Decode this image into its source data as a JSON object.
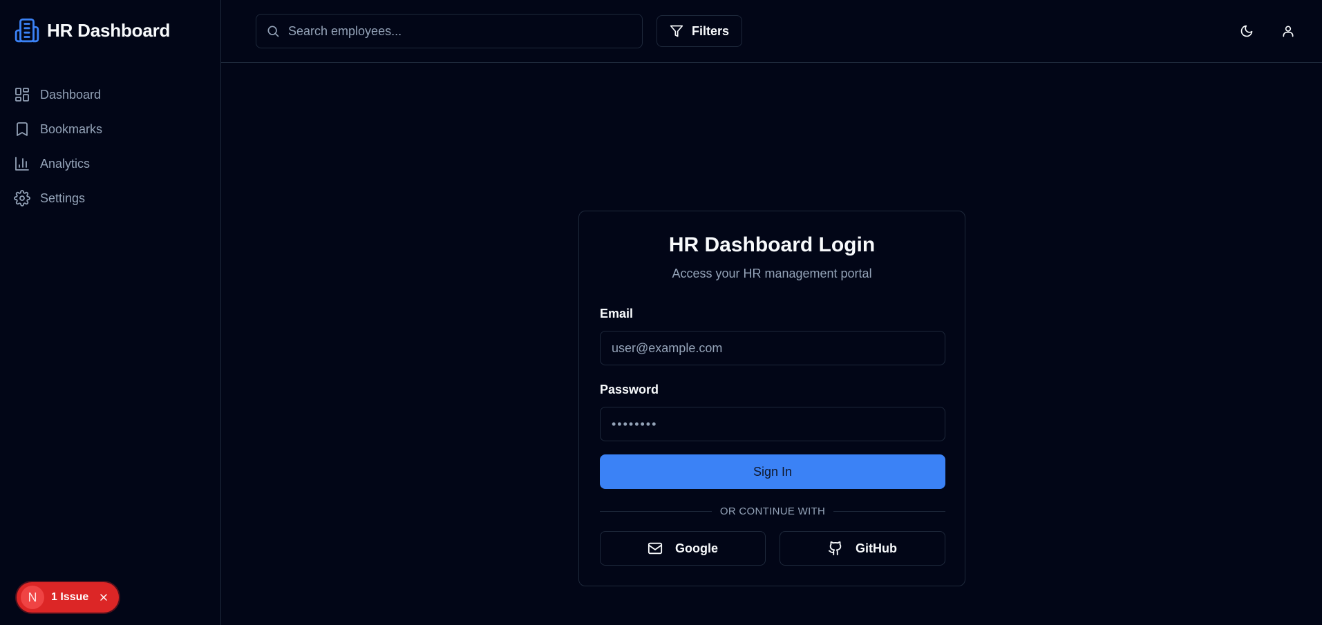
{
  "brand": {
    "title": "HR Dashboard",
    "icon": "building-icon",
    "accent": "#3b82f6"
  },
  "sidebar": {
    "items": [
      {
        "label": "Dashboard",
        "icon": "layout-grid-icon"
      },
      {
        "label": "Bookmarks",
        "icon": "bookmark-icon"
      },
      {
        "label": "Analytics",
        "icon": "bar-chart-icon"
      },
      {
        "label": "Settings",
        "icon": "gear-icon"
      }
    ]
  },
  "header": {
    "search_placeholder": "Search employees...",
    "filters_label": "Filters"
  },
  "issue_badge": {
    "letter": "N",
    "text": "1 Issue",
    "color": "#dc2626"
  },
  "login": {
    "title": "HR Dashboard Login",
    "subtitle": "Access your HR management portal",
    "email_label": "Email",
    "email_placeholder": "user@example.com",
    "password_label": "Password",
    "password_value": "••••••••",
    "signin_label": "Sign In",
    "divider_text": "OR CONTINUE WITH",
    "google_label": "Google",
    "github_label": "GitHub"
  }
}
